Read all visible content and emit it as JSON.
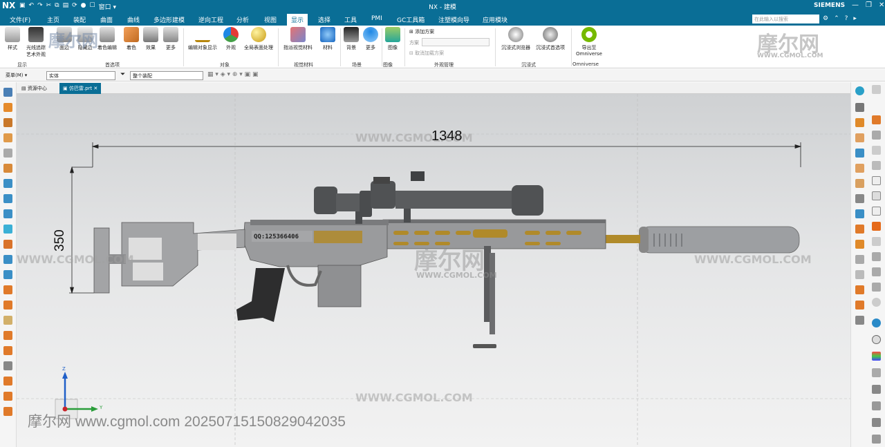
{
  "app": {
    "logo": "NX",
    "title": "NX - 建模",
    "brand": "SIEMENS",
    "quick_access_extra": "窗口 ▾"
  },
  "menu": {
    "file": "文件(F)",
    "items": [
      "主页",
      "装配",
      "曲面",
      "曲线",
      "多边形建模",
      "逆向工程",
      "分析",
      "视图",
      "显示",
      "选择",
      "工具",
      "PMI",
      "GC工具箱",
      "注塑模向导",
      "应用模块"
    ],
    "active": "显示",
    "search_placeholder": "在此输入以搜索"
  },
  "ribbon": {
    "buttons": [
      {
        "label": "样式",
        "label2": ""
      },
      {
        "label": "光线追踪",
        "label2": "艺术外观"
      },
      {
        "label": "面边",
        "label2": ""
      },
      {
        "label": "隐藏边",
        "label2": ""
      },
      {
        "label": "着色编辑",
        "label2": ""
      },
      {
        "label": "着色",
        "label2": ""
      },
      {
        "label": "效果",
        "label2": ""
      },
      {
        "label": "更多",
        "label2": ""
      },
      {
        "label": "编辑对象显示",
        "label2": ""
      },
      {
        "label": "外观",
        "label2": ""
      },
      {
        "label": "全局表面处理",
        "label2": ""
      },
      {
        "label": "指派视觉材料",
        "label2": ""
      },
      {
        "label": "材料",
        "label2": ""
      },
      {
        "label": "背景",
        "label2": ""
      },
      {
        "label": "更多",
        "label2": ""
      },
      {
        "label": "图像",
        "label2": ""
      },
      {
        "label": "沉浸式浏览器",
        "label2": ""
      },
      {
        "label": "沉浸式首选项",
        "label2": ""
      },
      {
        "label": "导出至",
        "label2": "Omniverse"
      }
    ],
    "groups": [
      "显示",
      "首选项",
      "对象",
      "视觉材料",
      "场景",
      "图像",
      "外观管理",
      "沉浸式",
      "Omniverse"
    ],
    "appearance_mgmt": {
      "add_scheme": "添加方案",
      "scheme_label": "方案",
      "cancel_load": "取消加载方案"
    }
  },
  "selection_bar": {
    "menu": "菜单(M) ▾",
    "filter": "实体",
    "scope": "整个装配"
  },
  "tabs": [
    {
      "label": "资源中心",
      "active": false
    },
    {
      "label": "仿巴雷.prt",
      "active": true
    }
  ],
  "viewport": {
    "dim_horizontal": "1348",
    "dim_vertical": "350",
    "serial_marking": "QQ:125366406",
    "watermark_url": "WWW.CGMOL.COM",
    "watermark_cn": "摩尔网",
    "stamp": "摩尔网 www.cgmol.com 20250715150829042035",
    "axis_z": "Z",
    "axis_y": "Y"
  },
  "colors": {
    "accent": "#0a6e96",
    "gun_body": "#9a9a9c",
    "gun_dark": "#4a4a4c",
    "bronze": "#b08a2a",
    "scope": "#555759"
  }
}
